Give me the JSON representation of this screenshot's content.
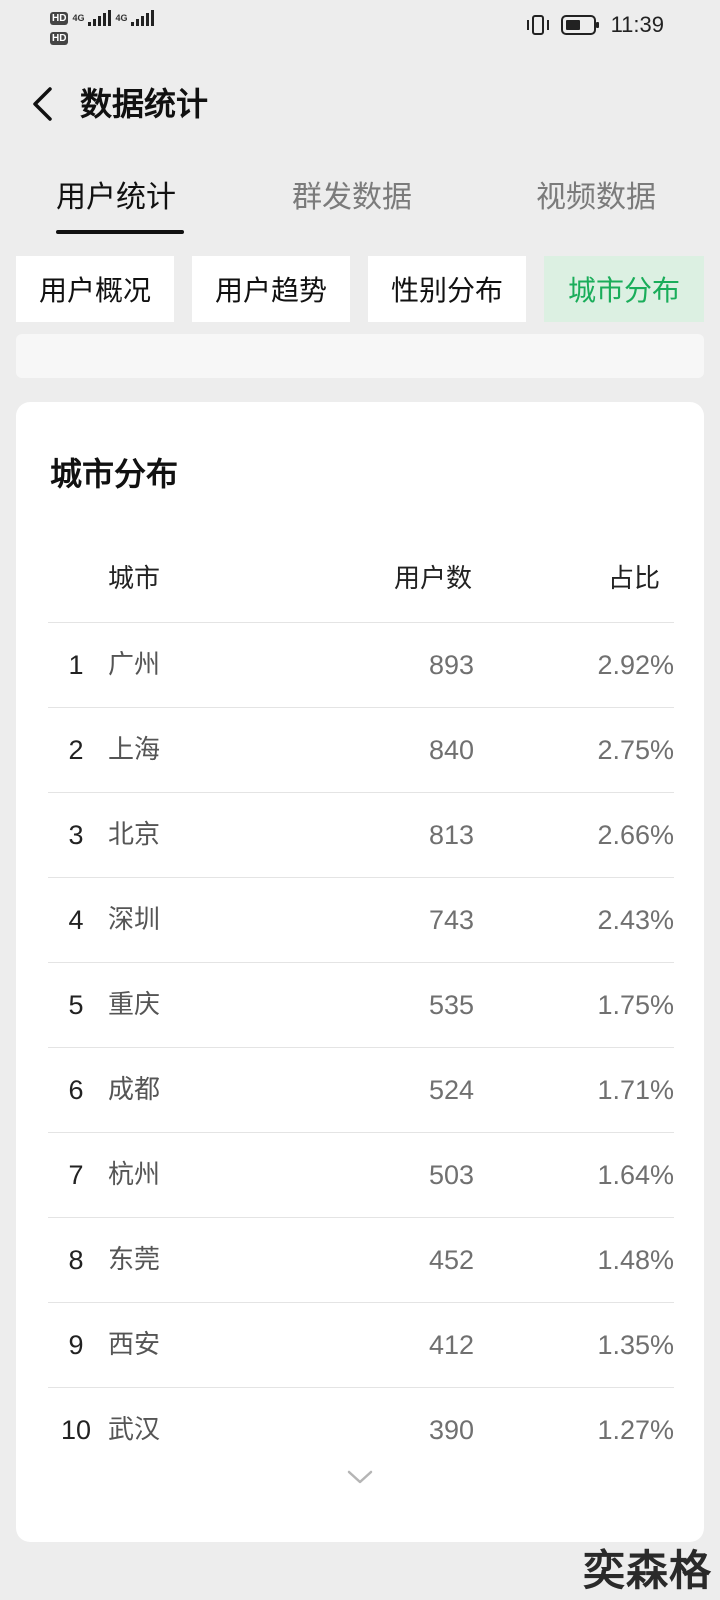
{
  "status_bar": {
    "hd_1": "HD",
    "hd_2": "HD",
    "network_1": "4G",
    "network_2": "4G",
    "time": "11:39",
    "icons": [
      "vibrate-icon",
      "battery-icon",
      "signal-icon"
    ]
  },
  "nav": {
    "title": "数据统计",
    "back_icon": "chevron-left-icon"
  },
  "main_tabs": [
    {
      "label": "用户统计",
      "active": true
    },
    {
      "label": "群发数据",
      "active": false
    },
    {
      "label": "视频数据",
      "active": false
    }
  ],
  "sub_tabs": [
    {
      "label": "用户概况",
      "active": false
    },
    {
      "label": "用户趋势",
      "active": false
    },
    {
      "label": "性别分布",
      "active": false
    },
    {
      "label": "城市分布",
      "active": true
    }
  ],
  "card": {
    "title": "城市分布",
    "columns": {
      "city": "城市",
      "users": "用户数",
      "ratio": "占比"
    },
    "rows": [
      {
        "rank": "1",
        "city": "广州",
        "users": "893",
        "ratio": "2.92%"
      },
      {
        "rank": "2",
        "city": "上海",
        "users": "840",
        "ratio": "2.75%"
      },
      {
        "rank": "3",
        "city": "北京",
        "users": "813",
        "ratio": "2.66%"
      },
      {
        "rank": "4",
        "city": "深圳",
        "users": "743",
        "ratio": "2.43%"
      },
      {
        "rank": "5",
        "city": "重庆",
        "users": "535",
        "ratio": "1.75%"
      },
      {
        "rank": "6",
        "city": "成都",
        "users": "524",
        "ratio": "1.71%"
      },
      {
        "rank": "7",
        "city": "杭州",
        "users": "503",
        "ratio": "1.64%"
      },
      {
        "rank": "8",
        "city": "东莞",
        "users": "452",
        "ratio": "1.48%"
      },
      {
        "rank": "9",
        "city": "西安",
        "users": "412",
        "ratio": "1.35%"
      },
      {
        "rank": "10",
        "city": "武汉",
        "users": "390",
        "ratio": "1.27%"
      }
    ],
    "expand_icon": "chevron-down-icon"
  },
  "watermark": "奕森格",
  "colors": {
    "background": "#ededed",
    "accent_green": "#1aad5a",
    "active_subtab_bg": "#dcf0e2",
    "card": "#ffffff"
  }
}
